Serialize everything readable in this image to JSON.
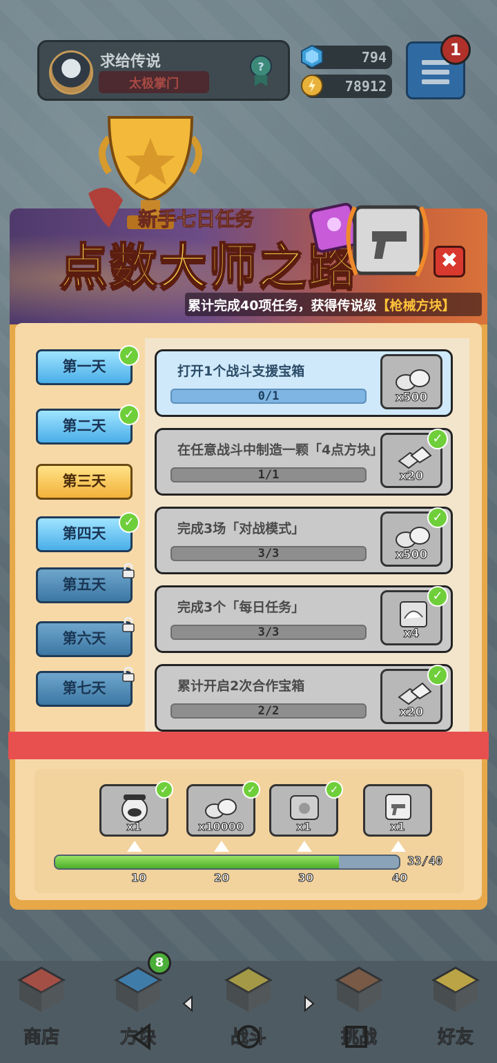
{
  "player": {
    "name": "求给传说",
    "title": "太极掌门",
    "gems": "794",
    "coins": "78912"
  },
  "menu": {
    "badge": "1"
  },
  "banner": {
    "subtitle": "新手七日任务",
    "title": "点数大师之路",
    "reward_prefix": "累计完成40项任务，获得传说级",
    "reward_item": "【枪械方块】",
    "close": "✖"
  },
  "days": [
    {
      "label": "第一天",
      "state": "done"
    },
    {
      "label": "第二天",
      "state": "done"
    },
    {
      "label": "第三天",
      "state": "active"
    },
    {
      "label": "第四天",
      "state": "done"
    },
    {
      "label": "第五天",
      "state": "locked"
    },
    {
      "label": "第六天",
      "state": "locked"
    },
    {
      "label": "第七天",
      "state": "locked"
    }
  ],
  "tasks": [
    {
      "label": "打开1个战斗支援宝箱",
      "progress": "0/1",
      "fraction": 0,
      "reward": "x500",
      "done": false
    },
    {
      "label": "在任意战斗中制造一颗「4点方块」",
      "progress": "1/1",
      "fraction": 1,
      "reward": "x20",
      "done": true
    },
    {
      "label": "完成3场「对战模式」",
      "progress": "3/3",
      "fraction": 1,
      "reward": "x500",
      "done": true
    },
    {
      "label": "完成3个「每日任务」",
      "progress": "3/3",
      "fraction": 1,
      "reward": "x4",
      "done": true
    },
    {
      "label": "累计开启2次合作宝箱",
      "progress": "2/2",
      "fraction": 1,
      "reward": "x20",
      "done": true
    }
  ],
  "milestones": {
    "items": [
      {
        "amount": "x1",
        "claimed": true
      },
      {
        "amount": "x10000",
        "claimed": true
      },
      {
        "amount": "x1",
        "claimed": true
      },
      {
        "amount": "x1",
        "claimed": false
      }
    ],
    "progress_text": "33/40",
    "progress_fraction": 0.825,
    "ticks": [
      "10",
      "20",
      "30",
      "40"
    ]
  },
  "nav": {
    "items": [
      "商店",
      "方块",
      "战斗",
      "挑战",
      "好友"
    ],
    "badge": "8"
  },
  "colors": {
    "panel": "#e7a84a",
    "done_check": "#6fcf3a",
    "red_bar": "#e85050",
    "progress_green": "#4cae2a"
  }
}
